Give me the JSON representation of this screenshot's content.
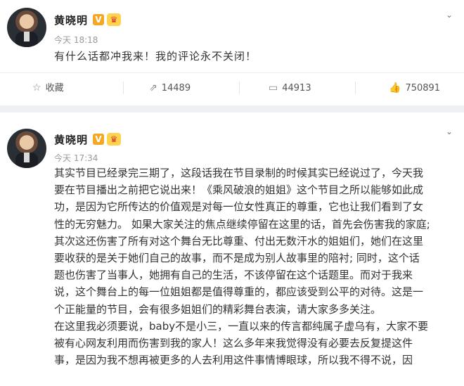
{
  "posts": [
    {
      "username": "黄晓明",
      "time": "今天 18:18",
      "text": "有什么话都冲我来！我的评论永不关闭！",
      "actions": {
        "favorite_label": "收藏",
        "repost_count": "14489",
        "comment_count": "44913",
        "like_count": "750891"
      }
    },
    {
      "username": "黄晓明",
      "time": "今天 17:34",
      "lines": [
        "其实节目已经录完三期了，这段话我在节目录制的时候其实已经说过了，今天我",
        "要在节目播出之前把它说出来！《乘风破浪的姐姐》这个节目之所以能够如此成",
        "功，是因为它所传达的价值观是对每一位女性真正的尊重，它也让我们看到了女",
        "性的无穷魅力。 如果大家关注的焦点继续停留在这里的话，首先会伤害我的家庭;",
        "其次这还伤害了所有对这个舞台无比尊重、付出无数汗水的姐姐们，她们在这里",
        "要收获的是关于她们自己的故事，而不是成为别人故事里的陪衬; 同时，这个话",
        "题也伤害了当事人，她拥有自己的生活，不该停留在这个话题里。而对于我来",
        "说，这个舞台上的每一位姐姐都是值得尊重的，都应该受到公平的对待。这是一",
        "个正能量的节目，会有很多姐姐们的精彩舞台表演，请大家多多关注。",
        "在这里我必须要说，baby不是小三，一直以来的传言都纯属子虚乌有，大家不要",
        "被有心网友利用而伤害到我的家人！这么多年来我觉得没有必要去反复提这件",
        "事，是因为我不想再被更多的人去利用这件事情博眼球，所以我不得不说，因"
      ]
    }
  ],
  "badges": {
    "verified": "V",
    "crown": "♛"
  },
  "icons": [
    "avatar",
    "verified-badge-icon",
    "crown-badge-icon",
    "chevron-down-icon",
    "star-icon",
    "repost-icon",
    "comment-icon",
    "like-icon"
  ],
  "colors": {
    "separator": "#eef0f3",
    "verified": "#f5a623",
    "muted": "#999999"
  }
}
